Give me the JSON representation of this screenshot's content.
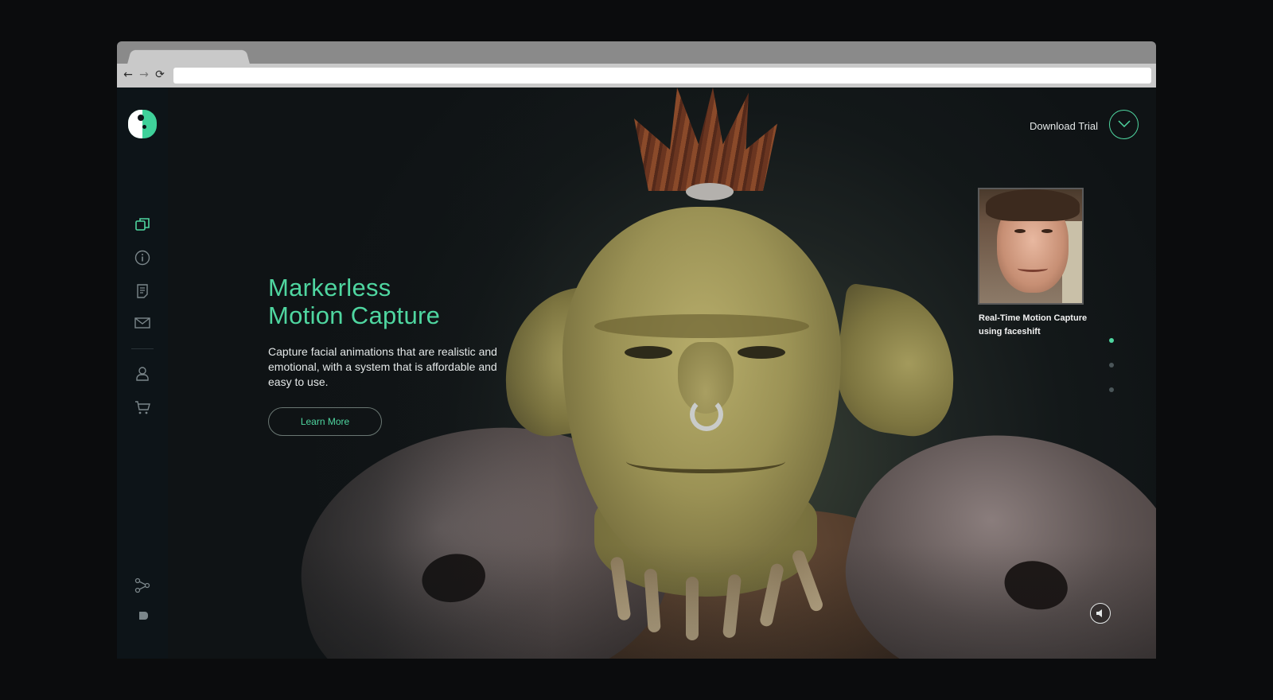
{
  "browser": {
    "address_value": "",
    "address_placeholder": "",
    "back_glyph": "←",
    "forward_glyph": "→",
    "reload_glyph": "⟳"
  },
  "sidebar": {
    "logo_icon": "faceshift-logo-icon",
    "items": [
      {
        "icon": "copy-icon",
        "active": true
      },
      {
        "icon": "info-icon",
        "active": false
      },
      {
        "icon": "document-icon",
        "active": false
      },
      {
        "icon": "mail-icon",
        "active": false
      },
      {
        "icon": "user-icon",
        "active": false
      },
      {
        "icon": "cart-icon",
        "active": false
      }
    ],
    "bottom_items": [
      {
        "icon": "share-icon"
      },
      {
        "icon": "social-icon"
      }
    ]
  },
  "hero": {
    "title": "Markerless\nMotion Capture",
    "description": "Capture facial animations that are realistic and emotional, with a system that is affordable and easy to use.",
    "button_label": "Learn More"
  },
  "header": {
    "download_label": "Download Trial",
    "download_icon": "chevron-down-icon"
  },
  "video": {
    "caption": "Real-Time Motion Capture using faceshift"
  },
  "slider": {
    "count": 3,
    "active_index": 0
  },
  "sound": {
    "icon": "speaker-icon"
  },
  "colors": {
    "accent": "#4fd6a0",
    "sidebar_bg": "#0d1418",
    "page_bg": "#0f1417",
    "text": "#e4e8e8"
  }
}
